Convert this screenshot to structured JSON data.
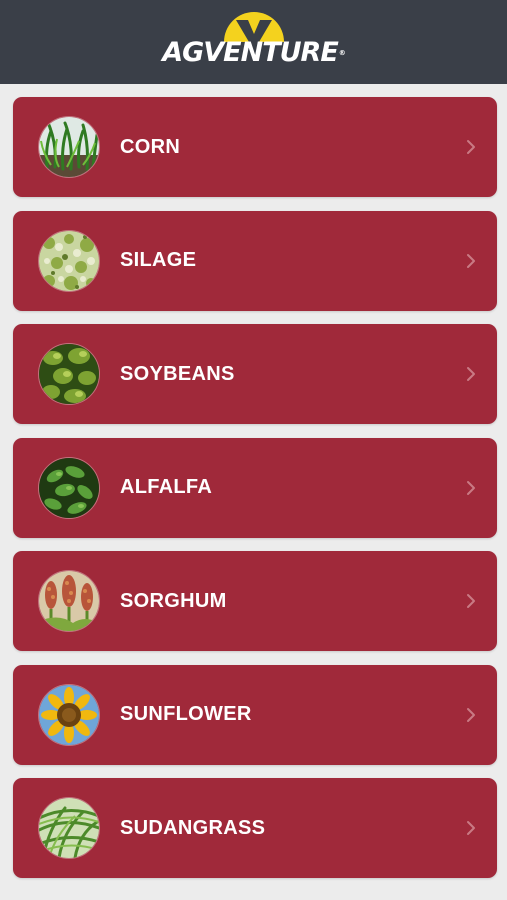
{
  "header": {
    "brand_name": "AGVENTURE",
    "trademark": "®",
    "brand_color": "#f4d21e",
    "bar_color": "#3a3f48"
  },
  "list": {
    "item_color": "#a0293a",
    "items": [
      {
        "label": "CORN",
        "icon": "corn-thumbnail"
      },
      {
        "label": "SILAGE",
        "icon": "silage-thumbnail"
      },
      {
        "label": "SOYBEANS",
        "icon": "soybeans-thumbnail"
      },
      {
        "label": "ALFALFA",
        "icon": "alfalfa-thumbnail"
      },
      {
        "label": "SORGHUM",
        "icon": "sorghum-thumbnail"
      },
      {
        "label": "SUNFLOWER",
        "icon": "sunflower-thumbnail"
      },
      {
        "label": "SUDANGRASS",
        "icon": "sudangrass-thumbnail"
      }
    ]
  }
}
